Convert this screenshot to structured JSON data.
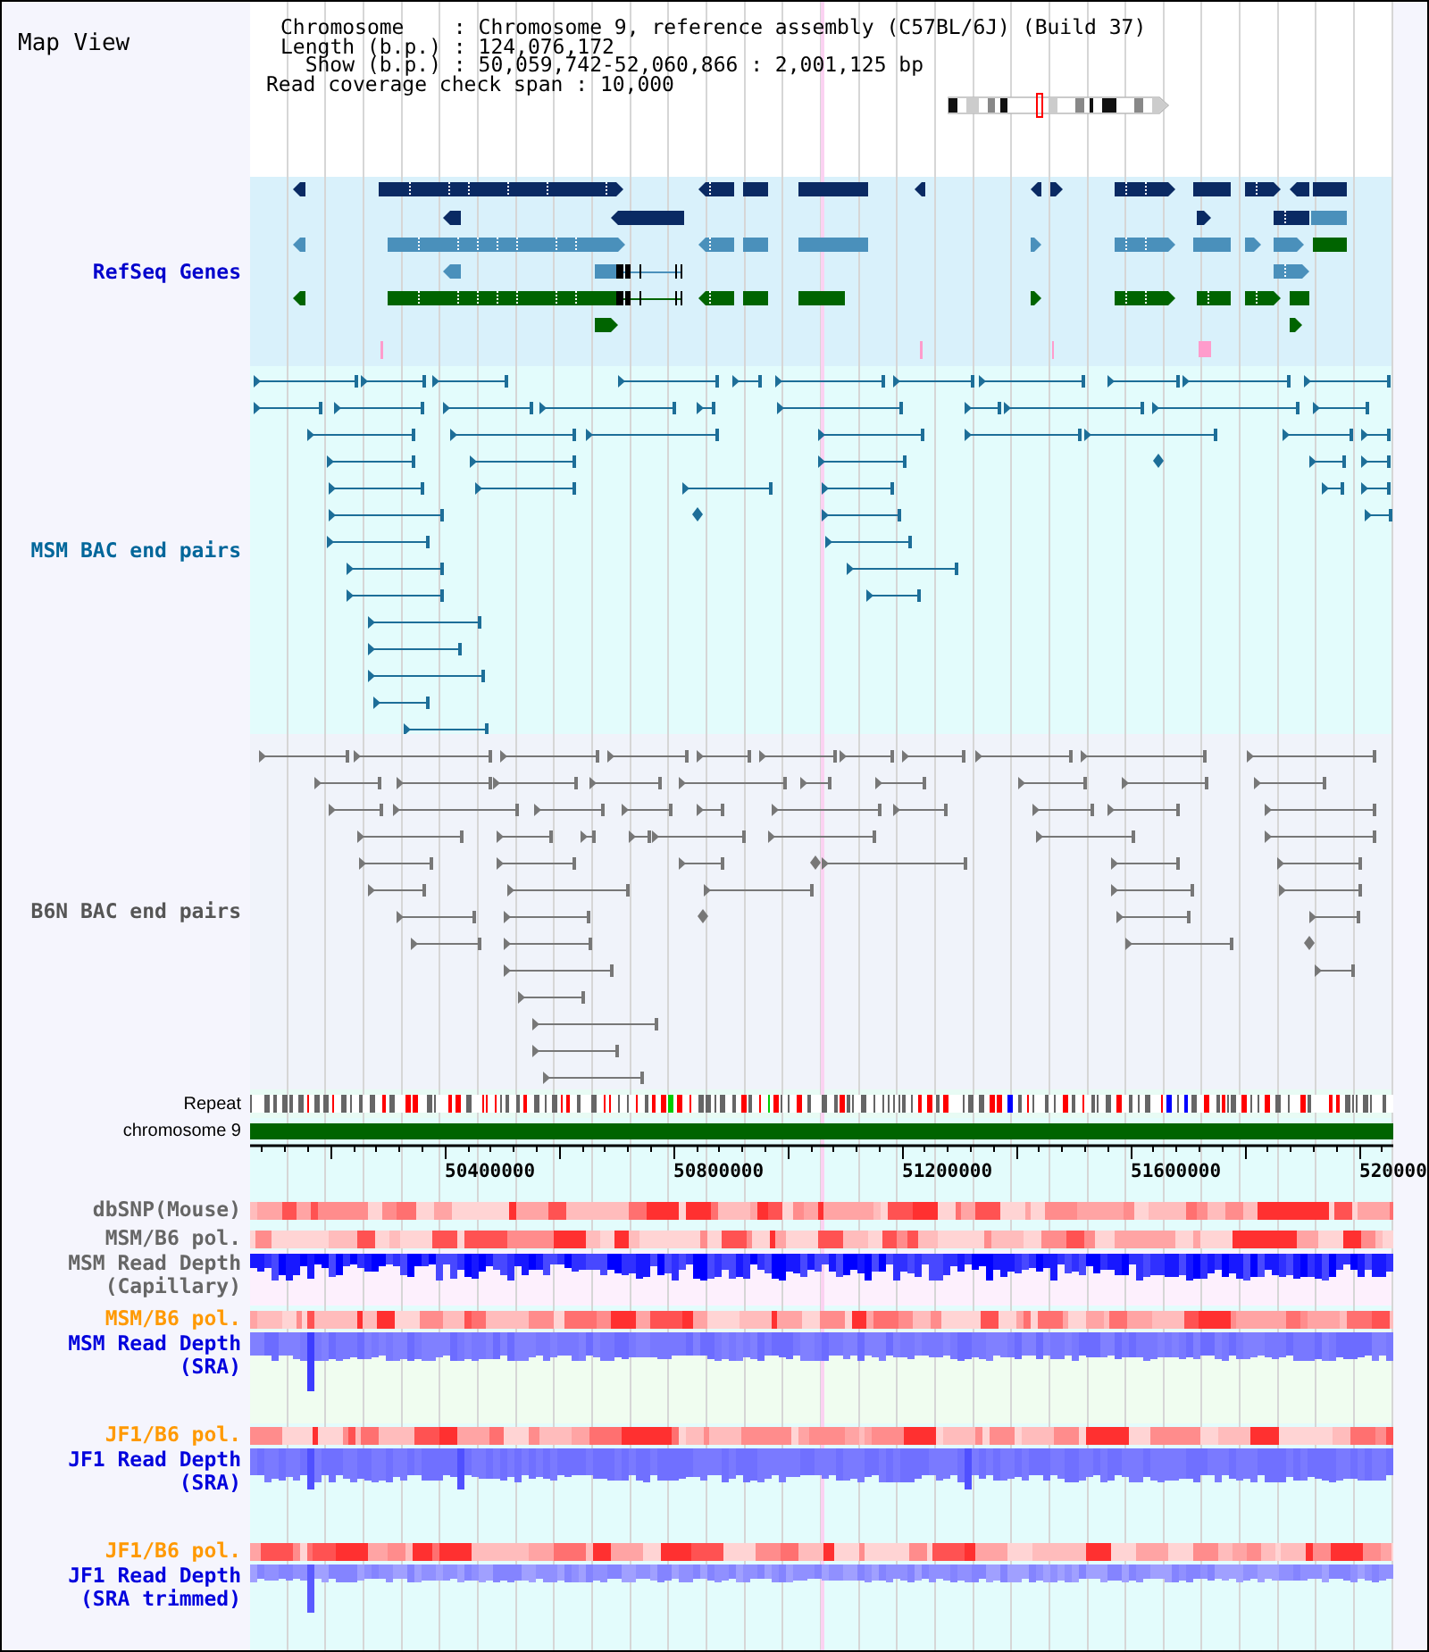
{
  "panel": {
    "title": "Map View"
  },
  "info": [
    {
      "label": "Chromosome",
      "value": ": Chromosome 9, reference assembly (C57BL/6J) (Build 37)"
    },
    {
      "label": "Length (b.p.)",
      "value": ": 124,076,172"
    },
    {
      "label": "Show (b.p.)",
      "value": ": 50,059,742-52,060,866 : 2,001,125 bp"
    }
  ],
  "coverage_span": {
    "label": "Read coverage check span",
    "value": ": 10,000"
  },
  "tracks": [
    {
      "kind": "genes",
      "label": "RefSeq Genes",
      "color": "#0000cc"
    },
    {
      "kind": "pairs",
      "label": "MSM BAC end pairs",
      "color": "#00669a"
    },
    {
      "kind": "pairs",
      "label": "B6N BAC end pairs",
      "color": "#555555"
    },
    {
      "kind": "repeat",
      "label": "Repeat",
      "color": "#000000"
    },
    {
      "kind": "chromosome",
      "label": "chromosome 9",
      "color": "#000000"
    }
  ],
  "ruler": {
    "ticks": [
      "50400000",
      "50800000",
      "51200000",
      "51600000",
      "520000"
    ]
  },
  "coverage_tracks": [
    {
      "kind": "heatmap",
      "label": "dbSNP(Mouse)",
      "color": "#666666"
    },
    {
      "kind": "heatmap",
      "label": "MSM/B6 pol.",
      "color": "#666666"
    },
    {
      "kind": "depth",
      "label": "MSM Read Depth (Capillary)",
      "color": "#666666"
    },
    {
      "kind": "heatmap",
      "label": "MSM/B6 pol.",
      "color": "#ff9900"
    },
    {
      "kind": "depth",
      "label": "MSM Read Depth (SRA)",
      "color": "#0000dd"
    },
    {
      "kind": "heatmap",
      "label": "JF1/B6 pol.",
      "color": "#ff9900"
    },
    {
      "kind": "depth",
      "label": "JF1 Read Depth (SRA)",
      "color": "#0000dd"
    },
    {
      "kind": "heatmap",
      "label": "JF1/B6 pol.",
      "color": "#ff9900"
    },
    {
      "kind": "depth",
      "label": "JF1 Read Depth (SRA trimmed)",
      "color": "#0000dd"
    }
  ]
}
